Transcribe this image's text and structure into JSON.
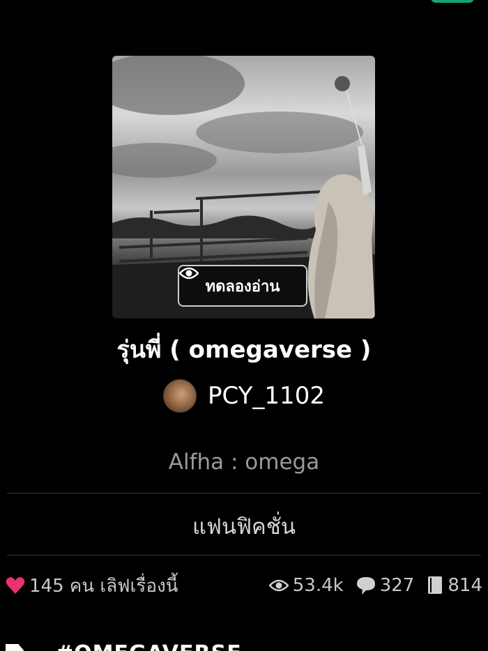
{
  "cover": {
    "preview_label": "ทดลองอ่าน"
  },
  "story": {
    "title": "รุ่นพี่ ( omegaverse )",
    "author": "PCY_1102",
    "tagline": "Alfha : omega",
    "category": "แฟนฟิคชั่น"
  },
  "stats": {
    "likes_text": "145 คน เลิฟเรื่องนี้",
    "views": "53.4k",
    "comments": "327",
    "chapters": "814"
  },
  "bottom": {
    "partial_text": "#OMEGAVERSE"
  },
  "colors": {
    "background": "#000000",
    "heart": "#e8336d",
    "accent": "#17a07a"
  }
}
